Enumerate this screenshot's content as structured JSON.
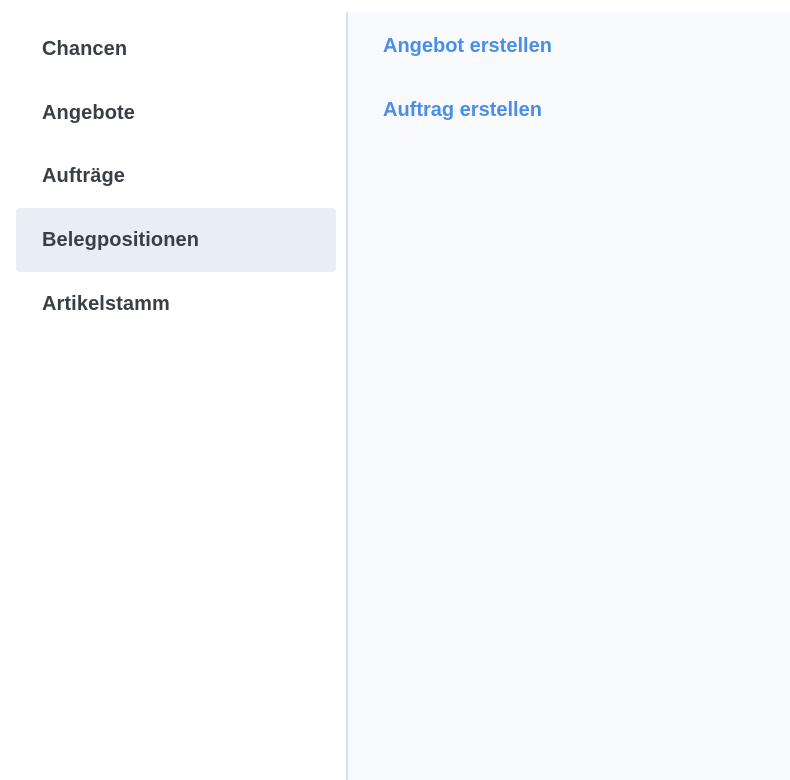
{
  "sidebar": {
    "items": [
      {
        "label": "Chancen",
        "active": false
      },
      {
        "label": "Angebote",
        "active": false
      },
      {
        "label": "Aufträge",
        "active": false
      },
      {
        "label": "Belegpositionen",
        "active": true
      },
      {
        "label": "Artikelstamm",
        "active": false
      }
    ],
    "active_background": "#e9eef4",
    "text_color": "#3a3f47"
  },
  "main": {
    "actions": [
      {
        "label": "Angebot erstellen"
      },
      {
        "label": "Auftrag erstellen"
      }
    ],
    "link_color": "#4a8fe7",
    "background": "#f8fafd"
  }
}
